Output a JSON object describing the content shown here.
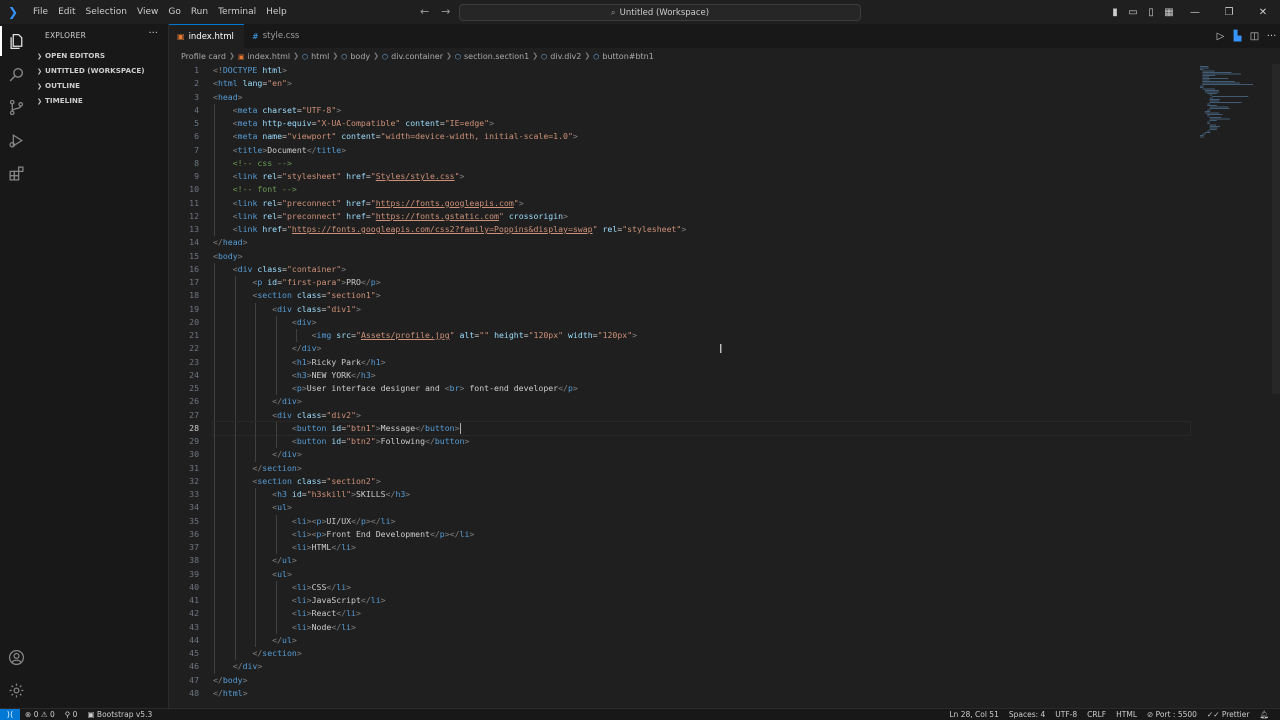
{
  "titlebar": {
    "menu": [
      "File",
      "Edit",
      "Selection",
      "View",
      "Go",
      "Run",
      "Terminal",
      "Help"
    ],
    "search_text": "Untitled (Workspace)"
  },
  "sidebar": {
    "title": "EXPLORER",
    "sections": [
      "OPEN EDITORS",
      "UNTITLED (WORKSPACE)",
      "OUTLINE",
      "TIMELINE"
    ]
  },
  "tabs": [
    {
      "label": "index.html",
      "active": true
    },
    {
      "label": "style.css",
      "active": false
    }
  ],
  "breadcrumbs": [
    "Profile card",
    "index.html",
    "html",
    "body",
    "div.container",
    "section.section1",
    "div.div2",
    "button#btn1"
  ],
  "editor": {
    "current_line": 28,
    "lines": [
      "<!DOCTYPE html>",
      "<html lang=\"en\">",
      "<head>",
      "    <meta charset=\"UTF-8\">",
      "    <meta http-equiv=\"X-UA-Compatible\" content=\"IE=edge\">",
      "    <meta name=\"viewport\" content=\"width=device-width, initial-scale=1.0\">",
      "    <title>Document</title>",
      "    <!-- css -->",
      "    <link rel=\"stylesheet\" href=\"Styles/style.css\">",
      "    <!-- font -->",
      "    <link rel=\"preconnect\" href=\"https://fonts.googleapis.com\">",
      "    <link rel=\"preconnect\" href=\"https://fonts.gstatic.com\" crossorigin>",
      "    <link href=\"https://fonts.googleapis.com/css2?family=Poppins&display=swap\" rel=\"stylesheet\">",
      "</head>",
      "<body>",
      "    <div class=\"container\">",
      "        <p id=\"first-para\">PRO</p>",
      "        <section class=\"section1\">",
      "            <div class=\"div1\">",
      "                <div>",
      "                    <img src=\"Assets/profile.jpg\" alt=\"\" height=\"120px\" width=\"120px\">",
      "                </div>",
      "                <h1>Ricky Park</h1>",
      "                <h3>NEW YORK</h3>",
      "                <p>User interface designer and <br> font-end developer</p>",
      "            </div>",
      "            <div class=\"div2\">",
      "                <button id=\"btn1\">Message</button>",
      "                <button id=\"btn2\">Following</button>",
      "            </div>",
      "        </section>",
      "        <section class=\"section2\">",
      "            <h3 id=\"h3skill\">SKILLS</h3>",
      "            <ul>",
      "                <li><p>UI/UX</p></li>",
      "                <li><p>Front End Development</p></li>",
      "                <li>HTML</li>",
      "            </ul>",
      "            <ul>",
      "                <li>CSS</li>",
      "                <li>JavaScript</li>",
      "                <li>React</li>",
      "                <li>Node</li>",
      "            </ul>",
      "        </section>",
      "    </div>",
      "</body>",
      "</html>"
    ]
  },
  "statusbar": {
    "problems_errors": "0",
    "problems_warnings": "0",
    "ports": "0",
    "extension": "Bootstrap v5.3",
    "cursor": "Ln 28, Col 51",
    "spaces": "Spaces: 4",
    "encoding": "UTF-8",
    "eol": "CRLF",
    "language": "HTML",
    "live_server": "Port : 5500",
    "prettier": "Prettier"
  },
  "colors": {
    "accent": "#0078d4",
    "tag": "#569cd6",
    "attr": "#9cdcfe",
    "string": "#ce9178",
    "comment": "#6a9955"
  }
}
